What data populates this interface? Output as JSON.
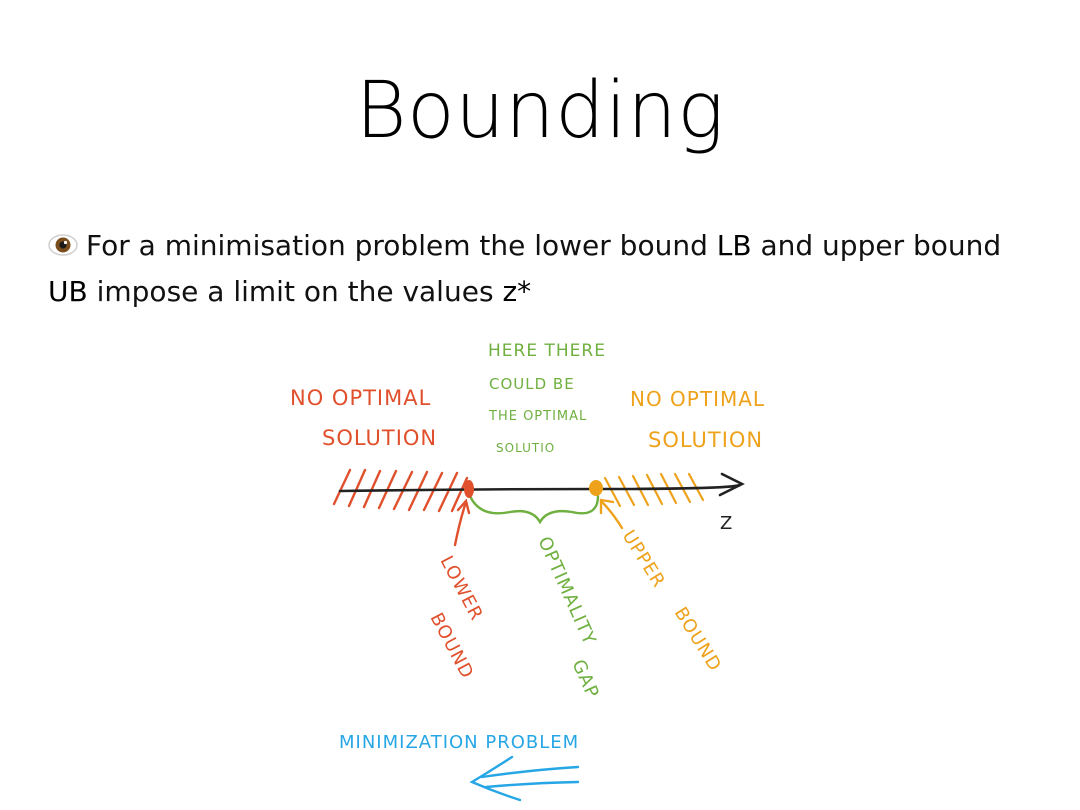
{
  "slide": {
    "title": "Bounding",
    "bullet": {
      "icon": "eye-icon",
      "text_before_lb": "For a minimisation problem the lower bound ",
      "lb": "LB",
      "text_between": " and upper bound ",
      "ub": "UB",
      "text_after_ub": " impose a limit on the values ",
      "z": "z*"
    }
  },
  "diagram": {
    "left_label": [
      "No optimal",
      "Solution"
    ],
    "middle_label": [
      "Here there",
      "could be",
      "the optimal",
      "solutio"
    ],
    "right_label": [
      "No optimal",
      "Solution"
    ],
    "axis_label": "Z",
    "lower_bound_label": [
      "Lower",
      "Bound"
    ],
    "gap_label": [
      "Optimality",
      "Gap"
    ],
    "upper_bound_label": [
      "Upper",
      "Bound"
    ],
    "direction_label": "Minimization problem",
    "colors": {
      "red": "#e0502d",
      "green": "#6fb040",
      "orange": "#eea21b",
      "blue": "#27a6e6",
      "black": "#222222"
    }
  }
}
